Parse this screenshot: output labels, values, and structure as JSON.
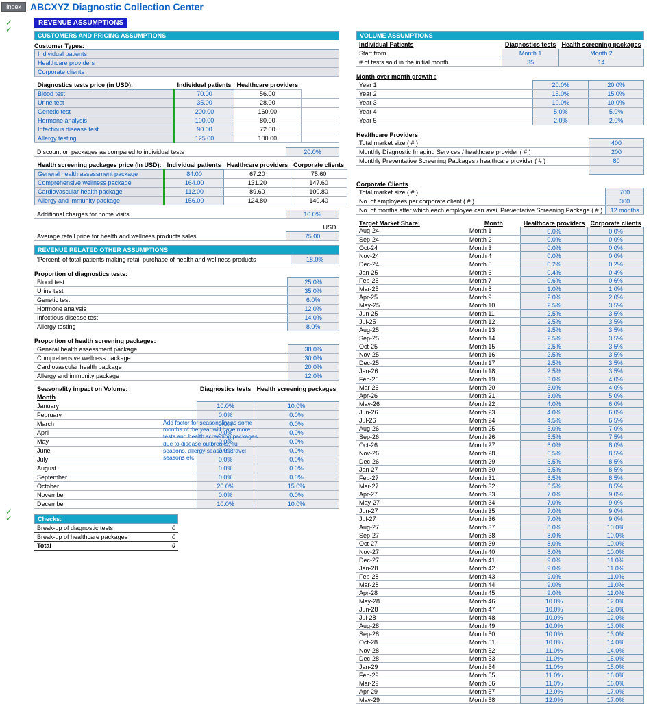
{
  "header": {
    "index": "Index",
    "title": "ABCXYZ Diagnostic Collection Center",
    "section": "REVENUE ASSUMPTIONS"
  },
  "left": {
    "hdr1": "CUSTOMERS AND PRICING ASSUMPTIONS",
    "cust_hdr": "Customer Types:",
    "cust": [
      "Individual patients",
      "Healthcare providers",
      "Corporate clients"
    ],
    "diag_hdr": "Diagnostics tests price (in USD):",
    "cols_diag": [
      "Individual patients",
      "Healthcare providers"
    ],
    "diag_rows": [
      {
        "n": "Blood test",
        "a": "70.00",
        "b": "56.00"
      },
      {
        "n": "Urine test",
        "a": "35.00",
        "b": "28.00"
      },
      {
        "n": "Genetic test",
        "a": "200.00",
        "b": "160.00"
      },
      {
        "n": "Hormone analysis",
        "a": "100.00",
        "b": "80.00"
      },
      {
        "n": "Infectious disease test",
        "a": "90.00",
        "b": "72.00"
      },
      {
        "n": "Allergy testing",
        "a": "125.00",
        "b": "100.00"
      }
    ],
    "discount_lbl": "Discount on packages as compared to individual tests",
    "discount_val": "20.0%",
    "pkg_hdr": "Health screening packages price (in USD):",
    "cols_pkg": [
      "Individual patients",
      "Healthcare providers",
      "Corporate clients"
    ],
    "pkg_rows": [
      {
        "n": "General health assessment package",
        "a": "84.00",
        "b": "67.20",
        "c": "75.60"
      },
      {
        "n": "Comprehensive wellness package",
        "a": "164.00",
        "b": "131.20",
        "c": "147.60"
      },
      {
        "n": "Cardiovascular health package",
        "a": "112.00",
        "b": "89.60",
        "c": "100.80"
      },
      {
        "n": "Allergy and immunity package",
        "a": "156.00",
        "b": "124.80",
        "c": "140.40"
      }
    ],
    "home_lbl": "Additional charges for home visits",
    "home_val": "10.0%",
    "usd": "USD",
    "retail_lbl": "Average retail price for health and wellness products sales",
    "retail_val": "75.00",
    "hdr2": "REVENUE RELATED OTHER ASSUMPTIONS",
    "pct_lbl": "'Percent' of total patients making retail purchase of health and wellness products",
    "pct_val": "18.0%",
    "prop_diag_hdr": "Proportion of diagnostics tests:",
    "prop_diag": [
      {
        "n": "Blood test",
        "v": "25.0%"
      },
      {
        "n": "Urine test",
        "v": "35.0%"
      },
      {
        "n": "Genetic test",
        "v": "6.0%"
      },
      {
        "n": "Hormone analysis",
        "v": "12.0%"
      },
      {
        "n": "Infectious disease test",
        "v": "14.0%"
      },
      {
        "n": "Allergy testing",
        "v": "8.0%"
      }
    ],
    "prop_pkg_hdr": "Proportion of health screening packages:",
    "prop_pkg": [
      {
        "n": "General health assessment package",
        "v": "38.0%"
      },
      {
        "n": "Comprehensive wellness package",
        "v": "30.0%"
      },
      {
        "n": "Cardiovascular health package",
        "v": "20.0%"
      },
      {
        "n": "Allergy and immunity package",
        "v": "12.0%"
      }
    ],
    "season_hdr": "Seasonality impact on Volume:",
    "season_cols": [
      "Diagnostics tests",
      "Health screening packages"
    ],
    "season_month": "Month",
    "season": [
      {
        "m": "January",
        "a": "10.0%",
        "b": "10.0%"
      },
      {
        "m": "February",
        "a": "0.0%",
        "b": "0.0%"
      },
      {
        "m": "March",
        "a": "0.0%",
        "b": "0.0%"
      },
      {
        "m": "April",
        "a": "0.0%",
        "b": "0.0%"
      },
      {
        "m": "May",
        "a": "0.0%",
        "b": "0.0%"
      },
      {
        "m": "June",
        "a": "0.0%",
        "b": "0.0%"
      },
      {
        "m": "July",
        "a": "0.0%",
        "b": "0.0%"
      },
      {
        "m": "August",
        "a": "0.0%",
        "b": "0.0%"
      },
      {
        "m": "September",
        "a": "0.0%",
        "b": "0.0%"
      },
      {
        "m": "October",
        "a": "20.0%",
        "b": "15.0%"
      },
      {
        "m": "November",
        "a": "0.0%",
        "b": "0.0%"
      },
      {
        "m": "December",
        "a": "10.0%",
        "b": "10.0%"
      }
    ],
    "note": "Add factor for seasonality as some months of the year will have more tests and health screening packages due to disease outbreaks, flu seasons, allergy seasons, travel seasons etc.",
    "checks_hdr": "Checks:",
    "checks": [
      {
        "n": "Break-up of diagnostic tests",
        "v": "0"
      },
      {
        "n": "Break-up of healthcare packages",
        "v": "0"
      }
    ],
    "total_lbl": "Total",
    "total_val": "0"
  },
  "right": {
    "hdr": "VOLUME ASSUMPTIONS",
    "ind_hdr": "Individual Patients",
    "cols": [
      "Diagnostics tests",
      "Health screening packages"
    ],
    "start_lbl": "Start from",
    "start": [
      "Month 1",
      "Month 2"
    ],
    "sold_lbl": "# of tests sold in the initial month",
    "sold": [
      "35",
      "14"
    ],
    "mom_hdr": "Month over month growth :",
    "years": [
      {
        "n": "Year 1",
        "a": "20.0%",
        "b": "20.0%"
      },
      {
        "n": "Year 2",
        "a": "15.0%",
        "b": "15.0%"
      },
      {
        "n": "Year 3",
        "a": "10.0%",
        "b": "10.0%"
      },
      {
        "n": "Year 4",
        "a": "5.0%",
        "b": "5.0%"
      },
      {
        "n": "Year 5",
        "a": "2.0%",
        "b": "2.0%"
      }
    ],
    "hp_hdr": "Healthcare Providers",
    "hp": [
      {
        "n": "Total market size ( # )",
        "v": "400"
      },
      {
        "n": "Monthly Diagnostic Imaging Services / healthcare provider ( # )",
        "v": "200"
      },
      {
        "n": "Monthly Preventative Screening Packages / healthcare provider ( # )",
        "v": "80"
      }
    ],
    "cc_hdr": "Corporate Clients",
    "cc": [
      {
        "n": "Total market size ( # )",
        "v": "700"
      },
      {
        "n": "No. of employees per corporate client ( # )",
        "v": "300"
      },
      {
        "n": "No. of months after which each employee can avail Preventative Screening Package ( # )",
        "v": "12 months"
      }
    ],
    "tms_hdr": "Target Market Share:",
    "tms_cols": [
      "Month",
      "Healthcare providers",
      "Corporate clients"
    ],
    "tms": [
      {
        "d": "Aug-24",
        "m": "Month 1",
        "a": "0.0%",
        "b": "0.0%"
      },
      {
        "d": "Sep-24",
        "m": "Month 2",
        "a": "0.0%",
        "b": "0.0%"
      },
      {
        "d": "Oct-24",
        "m": "Month 3",
        "a": "0.0%",
        "b": "0.0%"
      },
      {
        "d": "Nov-24",
        "m": "Month 4",
        "a": "0.0%",
        "b": "0.0%"
      },
      {
        "d": "Dec-24",
        "m": "Month 5",
        "a": "0.2%",
        "b": "0.2%"
      },
      {
        "d": "Jan-25",
        "m": "Month 6",
        "a": "0.4%",
        "b": "0.4%"
      },
      {
        "d": "Feb-25",
        "m": "Month 7",
        "a": "0.6%",
        "b": "0.6%"
      },
      {
        "d": "Mar-25",
        "m": "Month 8",
        "a": "1.0%",
        "b": "1.0%"
      },
      {
        "d": "Apr-25",
        "m": "Month 9",
        "a": "2.0%",
        "b": "2.0%"
      },
      {
        "d": "May-25",
        "m": "Month 10",
        "a": "2.5%",
        "b": "3.5%"
      },
      {
        "d": "Jun-25",
        "m": "Month 11",
        "a": "2.5%",
        "b": "3.5%"
      },
      {
        "d": "Jul-25",
        "m": "Month 12",
        "a": "2.5%",
        "b": "3.5%"
      },
      {
        "d": "Aug-25",
        "m": "Month 13",
        "a": "2.5%",
        "b": "3.5%"
      },
      {
        "d": "Sep-25",
        "m": "Month 14",
        "a": "2.5%",
        "b": "3.5%"
      },
      {
        "d": "Oct-25",
        "m": "Month 15",
        "a": "2.5%",
        "b": "3.5%"
      },
      {
        "d": "Nov-25",
        "m": "Month 16",
        "a": "2.5%",
        "b": "3.5%"
      },
      {
        "d": "Dec-25",
        "m": "Month 17",
        "a": "2.5%",
        "b": "3.5%"
      },
      {
        "d": "Jan-26",
        "m": "Month 18",
        "a": "2.5%",
        "b": "3.5%"
      },
      {
        "d": "Feb-26",
        "m": "Month 19",
        "a": "3.0%",
        "b": "4.0%"
      },
      {
        "d": "Mar-26",
        "m": "Month 20",
        "a": "3.0%",
        "b": "4.0%"
      },
      {
        "d": "Apr-26",
        "m": "Month 21",
        "a": "3.0%",
        "b": "5.0%"
      },
      {
        "d": "May-26",
        "m": "Month 22",
        "a": "4.0%",
        "b": "6.0%"
      },
      {
        "d": "Jun-26",
        "m": "Month 23",
        "a": "4.0%",
        "b": "6.0%"
      },
      {
        "d": "Jul-26",
        "m": "Month 24",
        "a": "4.5%",
        "b": "6.5%"
      },
      {
        "d": "Aug-26",
        "m": "Month 25",
        "a": "5.0%",
        "b": "7.0%"
      },
      {
        "d": "Sep-26",
        "m": "Month 26",
        "a": "5.5%",
        "b": "7.5%"
      },
      {
        "d": "Oct-26",
        "m": "Month 27",
        "a": "6.0%",
        "b": "8.0%"
      },
      {
        "d": "Nov-26",
        "m": "Month 28",
        "a": "6.5%",
        "b": "8.5%"
      },
      {
        "d": "Dec-26",
        "m": "Month 29",
        "a": "6.5%",
        "b": "8.5%"
      },
      {
        "d": "Jan-27",
        "m": "Month 30",
        "a": "6.5%",
        "b": "8.5%"
      },
      {
        "d": "Feb-27",
        "m": "Month 31",
        "a": "6.5%",
        "b": "8.5%"
      },
      {
        "d": "Mar-27",
        "m": "Month 32",
        "a": "6.5%",
        "b": "8.5%"
      },
      {
        "d": "Apr-27",
        "m": "Month 33",
        "a": "7.0%",
        "b": "9.0%"
      },
      {
        "d": "May-27",
        "m": "Month 34",
        "a": "7.0%",
        "b": "9.0%"
      },
      {
        "d": "Jun-27",
        "m": "Month 35",
        "a": "7.0%",
        "b": "9.0%"
      },
      {
        "d": "Jul-27",
        "m": "Month 36",
        "a": "7.0%",
        "b": "9.0%"
      },
      {
        "d": "Aug-27",
        "m": "Month 37",
        "a": "8.0%",
        "b": "10.0%"
      },
      {
        "d": "Sep-27",
        "m": "Month 38",
        "a": "8.0%",
        "b": "10.0%"
      },
      {
        "d": "Oct-27",
        "m": "Month 39",
        "a": "8.0%",
        "b": "10.0%"
      },
      {
        "d": "Nov-27",
        "m": "Month 40",
        "a": "8.0%",
        "b": "10.0%"
      },
      {
        "d": "Dec-27",
        "m": "Month 41",
        "a": "9.0%",
        "b": "11.0%"
      },
      {
        "d": "Jan-28",
        "m": "Month 42",
        "a": "9.0%",
        "b": "11.0%"
      },
      {
        "d": "Feb-28",
        "m": "Month 43",
        "a": "9.0%",
        "b": "11.0%"
      },
      {
        "d": "Mar-28",
        "m": "Month 44",
        "a": "9.0%",
        "b": "11.0%"
      },
      {
        "d": "Apr-28",
        "m": "Month 45",
        "a": "9.0%",
        "b": "11.0%"
      },
      {
        "d": "May-28",
        "m": "Month 46",
        "a": "10.0%",
        "b": "12.0%"
      },
      {
        "d": "Jun-28",
        "m": "Month 47",
        "a": "10.0%",
        "b": "12.0%"
      },
      {
        "d": "Jul-28",
        "m": "Month 48",
        "a": "10.0%",
        "b": "12.0%"
      },
      {
        "d": "Aug-28",
        "m": "Month 49",
        "a": "10.0%",
        "b": "13.0%"
      },
      {
        "d": "Sep-28",
        "m": "Month 50",
        "a": "10.0%",
        "b": "13.0%"
      },
      {
        "d": "Oct-28",
        "m": "Month 51",
        "a": "10.0%",
        "b": "14.0%"
      },
      {
        "d": "Nov-28",
        "m": "Month 52",
        "a": "11.0%",
        "b": "14.0%"
      },
      {
        "d": "Dec-28",
        "m": "Month 53",
        "a": "11.0%",
        "b": "15.0%"
      },
      {
        "d": "Jan-29",
        "m": "Month 54",
        "a": "11.0%",
        "b": "15.0%"
      },
      {
        "d": "Feb-29",
        "m": "Month 55",
        "a": "11.0%",
        "b": "16.0%"
      },
      {
        "d": "Mar-29",
        "m": "Month 56",
        "a": "11.0%",
        "b": "16.0%"
      },
      {
        "d": "Apr-29",
        "m": "Month 57",
        "a": "12.0%",
        "b": "17.0%"
      },
      {
        "d": "May-29",
        "m": "Month 58",
        "a": "12.0%",
        "b": "17.0%"
      }
    ]
  }
}
